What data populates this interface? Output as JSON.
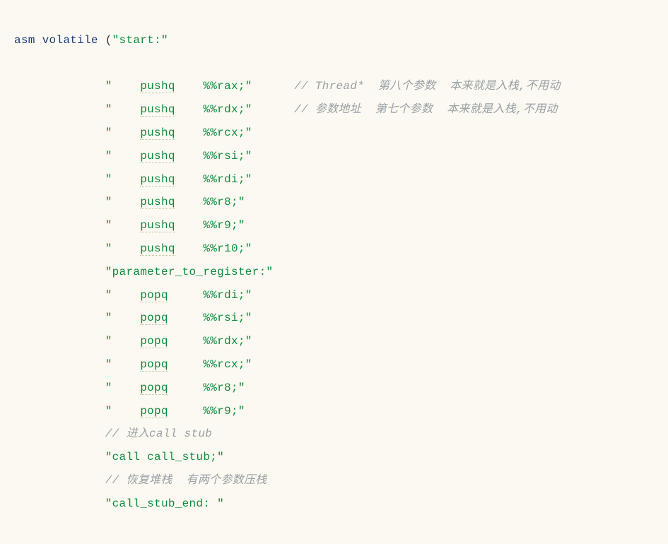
{
  "keywords": {
    "asm": "asm",
    "volatile": "volatile"
  },
  "paren": "(",
  "start_label": "\"start:\"",
  "lines": [
    {
      "pre": "\"    ",
      "mid": "pushq",
      "post": "    %%rax;\"",
      "comment": "// Thread*  第八个参数  本来就是入栈,不用动"
    },
    {
      "pre": "\"    ",
      "mid": "pushq",
      "post": "    %%rdx;\"",
      "comment": "// 参数地址  第七个参数  本来就是入栈,不用动"
    },
    {
      "pre": "\"    ",
      "mid": "pushq",
      "post": "    %%rcx;\"",
      "comment": ""
    },
    {
      "pre": "\"    ",
      "mid": "pushq",
      "post": "    %%rsi;\"",
      "comment": ""
    },
    {
      "pre": "\"    ",
      "mid": "pushq",
      "post": "    %%rdi;\"",
      "comment": ""
    },
    {
      "pre": "\"    ",
      "mid": "pushq",
      "post": "    %%r8;\"",
      "comment": ""
    },
    {
      "pre": "\"    ",
      "mid": "pushq",
      "post": "    %%r9;\"",
      "comment": ""
    },
    {
      "pre": "\"    ",
      "mid": "pushq",
      "post": "    %%r10;\"",
      "comment": ""
    },
    {
      "plain": "\"parameter_to_register:\""
    },
    {
      "pre": "\"    ",
      "mid": "popq",
      "post": "     %%rdi;\"",
      "comment": ""
    },
    {
      "pre": "\"    ",
      "mid": "popq",
      "post": "     %%rsi;\"",
      "comment": ""
    },
    {
      "pre": "\"    ",
      "mid": "popq",
      "post": "     %%rdx;\"",
      "comment": ""
    },
    {
      "pre": "\"    ",
      "mid": "popq",
      "post": "     %%rcx;\"",
      "comment": ""
    },
    {
      "pre": "\"    ",
      "mid": "popq",
      "post": "     %%r8;\"",
      "comment": ""
    },
    {
      "pre": "\"    ",
      "mid": "popq",
      "post": "     %%r9;\"",
      "comment": ""
    },
    {
      "commentOnly": "// 进入call stub"
    },
    {
      "plain": "\"call call_stub;\""
    },
    {
      "commentOnly": "// 恢复堆栈  有两个参数压栈"
    },
    {
      "plain": "\"call_stub_end: \""
    }
  ],
  "indent": "             "
}
